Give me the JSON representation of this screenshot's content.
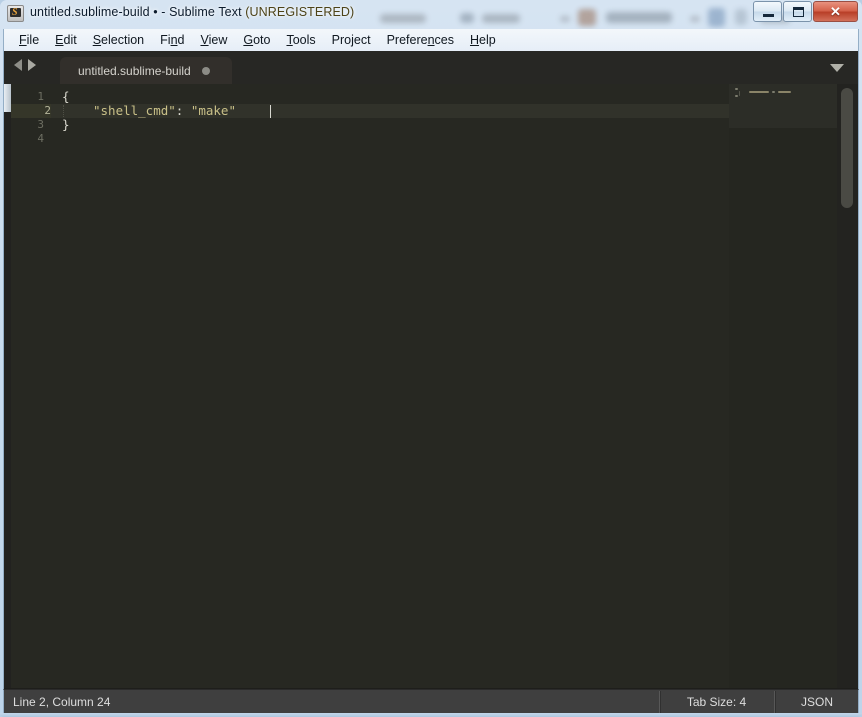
{
  "window": {
    "title_file": "untitled.sublime-build",
    "title_dirty_marker": "•",
    "title_app": "- Sublime Text",
    "title_status": "(UNREGISTERED)",
    "app_icon": "sublime-text-icon",
    "controls": {
      "minimize": "minimize-icon",
      "maximize": "maximize-icon",
      "close": "✕"
    }
  },
  "menubar": {
    "items": [
      {
        "label": "File",
        "mnemonic": "F",
        "rest": "ile"
      },
      {
        "label": "Edit",
        "mnemonic": "E",
        "rest": "dit"
      },
      {
        "label": "Selection",
        "mnemonic": "S",
        "rest": "election"
      },
      {
        "label": "Find",
        "mnemonic": "n",
        "pre": "Fi",
        "rest": "d"
      },
      {
        "label": "View",
        "mnemonic": "V",
        "rest": "iew"
      },
      {
        "label": "Goto",
        "mnemonic": "G",
        "rest": "oto"
      },
      {
        "label": "Tools",
        "mnemonic": "T",
        "rest": "ools"
      },
      {
        "label": "Project",
        "mnemonic": "P",
        "rest": "roject"
      },
      {
        "label": "Preferences",
        "mnemonic": "n",
        "pre": "Prefere",
        "rest": "ces"
      },
      {
        "label": "Help",
        "mnemonic": "H",
        "rest": "elp"
      }
    ]
  },
  "tabbar": {
    "nav_prev": "arrow-left-icon",
    "nav_next": "arrow-right-icon",
    "tabs": [
      {
        "label": "untitled.sublime-build",
        "dirty": true,
        "active": true
      }
    ],
    "overflow_menu": "chevron-down-icon"
  },
  "editor": {
    "syntax": "JSON",
    "line_numbers": [
      "1",
      "2",
      "3",
      "4"
    ],
    "active_line": 2,
    "lines": [
      {
        "n": 1,
        "segments": [
          {
            "text": "{",
            "kind": "punct"
          }
        ]
      },
      {
        "n": 2,
        "segments": [
          {
            "text": "    ",
            "kind": "plain"
          },
          {
            "text": "\"shell_cmd\"",
            "kind": "str"
          },
          {
            "text": ":",
            "kind": "colon"
          },
          {
            "text": " ",
            "kind": "plain"
          },
          {
            "text": "\"make\"",
            "kind": "str"
          }
        ]
      },
      {
        "n": 3,
        "segments": [
          {
            "text": "}",
            "kind": "punct"
          }
        ]
      },
      {
        "n": 4,
        "segments": []
      }
    ],
    "raw_text": "{\n    \"shell_cmd\": \"make\"\n}\n"
  },
  "statusbar": {
    "cursor_position": "Line 2, Column 24",
    "tab_size": "Tab Size: 4",
    "syntax": "JSON"
  },
  "colors": {
    "editor_background": "#272822",
    "active_line": "#31322a",
    "string": "#c9c088",
    "punctuation": "#d9d8ce",
    "tabbar_background": "#272724",
    "active_tab": "#322f2b",
    "statusbar_background": "#3f3f3f",
    "frame": "#bdd4ea",
    "close_button": "#b93f28"
  }
}
